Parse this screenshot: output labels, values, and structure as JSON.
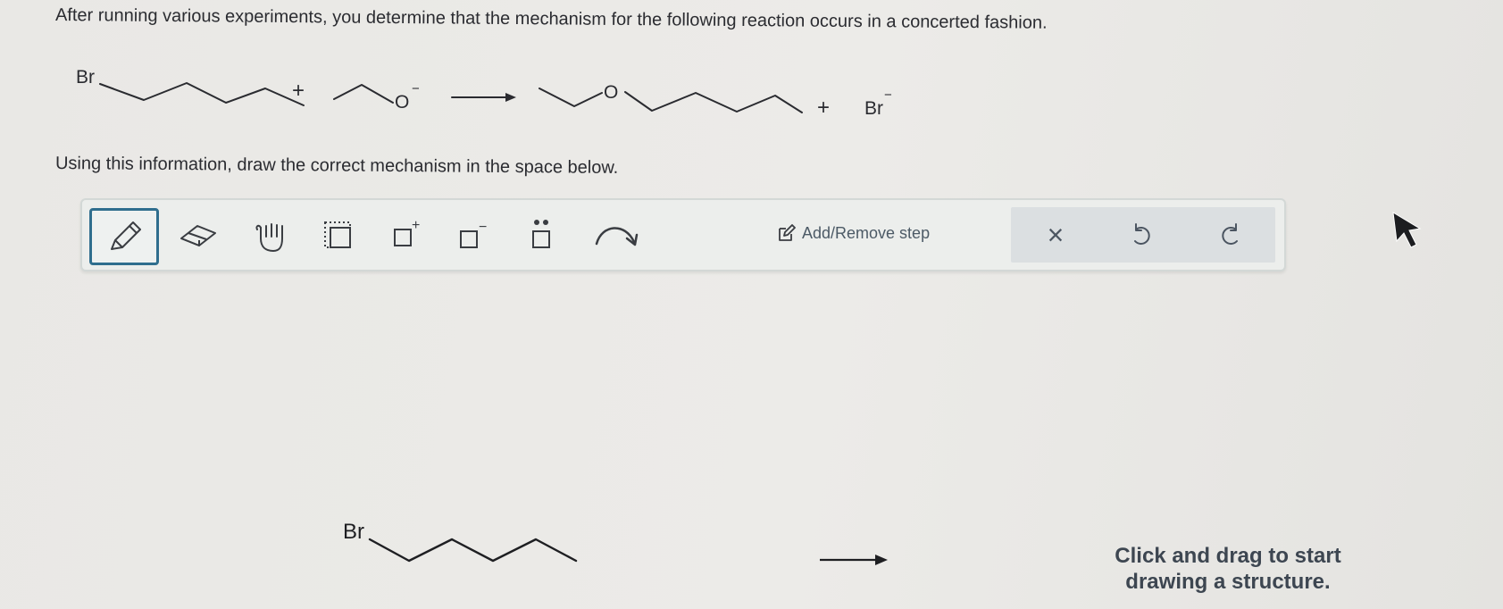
{
  "question": {
    "text": "After running various experiments, you determine that the mechanism for the following reaction occurs in a concerted fashion."
  },
  "reaction": {
    "reactant1_atom": "Br",
    "plus_1": "+",
    "reactant2_atom": "O",
    "reactant2_charge": "−",
    "product1_atom": "O",
    "plus_2": "+",
    "product2_atom": "Br",
    "product2_charge": "−"
  },
  "instruction": {
    "text": "Using this information, draw the correct mechanism in the space below."
  },
  "toolbar": {
    "tools": [
      {
        "name": "pencil",
        "icon": "pencil-icon",
        "active": true
      },
      {
        "name": "eraser",
        "icon": "eraser-icon",
        "active": false
      },
      {
        "name": "move",
        "icon": "hand-icon",
        "active": false
      },
      {
        "name": "select",
        "icon": "lasso-select-icon",
        "active": false
      },
      {
        "name": "positive charge",
        "icon": "positive-charge-icon",
        "active": false
      },
      {
        "name": "negative charge",
        "icon": "negative-charge-icon",
        "active": false
      },
      {
        "name": "lone pair",
        "icon": "lone-pair-icon",
        "active": false
      },
      {
        "name": "curved arrow",
        "icon": "curved-arrow-icon",
        "active": false
      }
    ],
    "charge_plus_symbol": "+",
    "charge_minus_symbol": "−",
    "step_label": "Add/Remove step",
    "clear_label": "×"
  },
  "canvas": {
    "substrate_atom": "Br",
    "hint_line1": "Click and drag to start",
    "hint_line2": "drawing a structure."
  },
  "colors": {
    "active_tool_border": "#2f6e8e",
    "toolbar_bg": "#eceeec",
    "right_panel_bg": "#dbdfe1",
    "text": "#2b2c31"
  }
}
